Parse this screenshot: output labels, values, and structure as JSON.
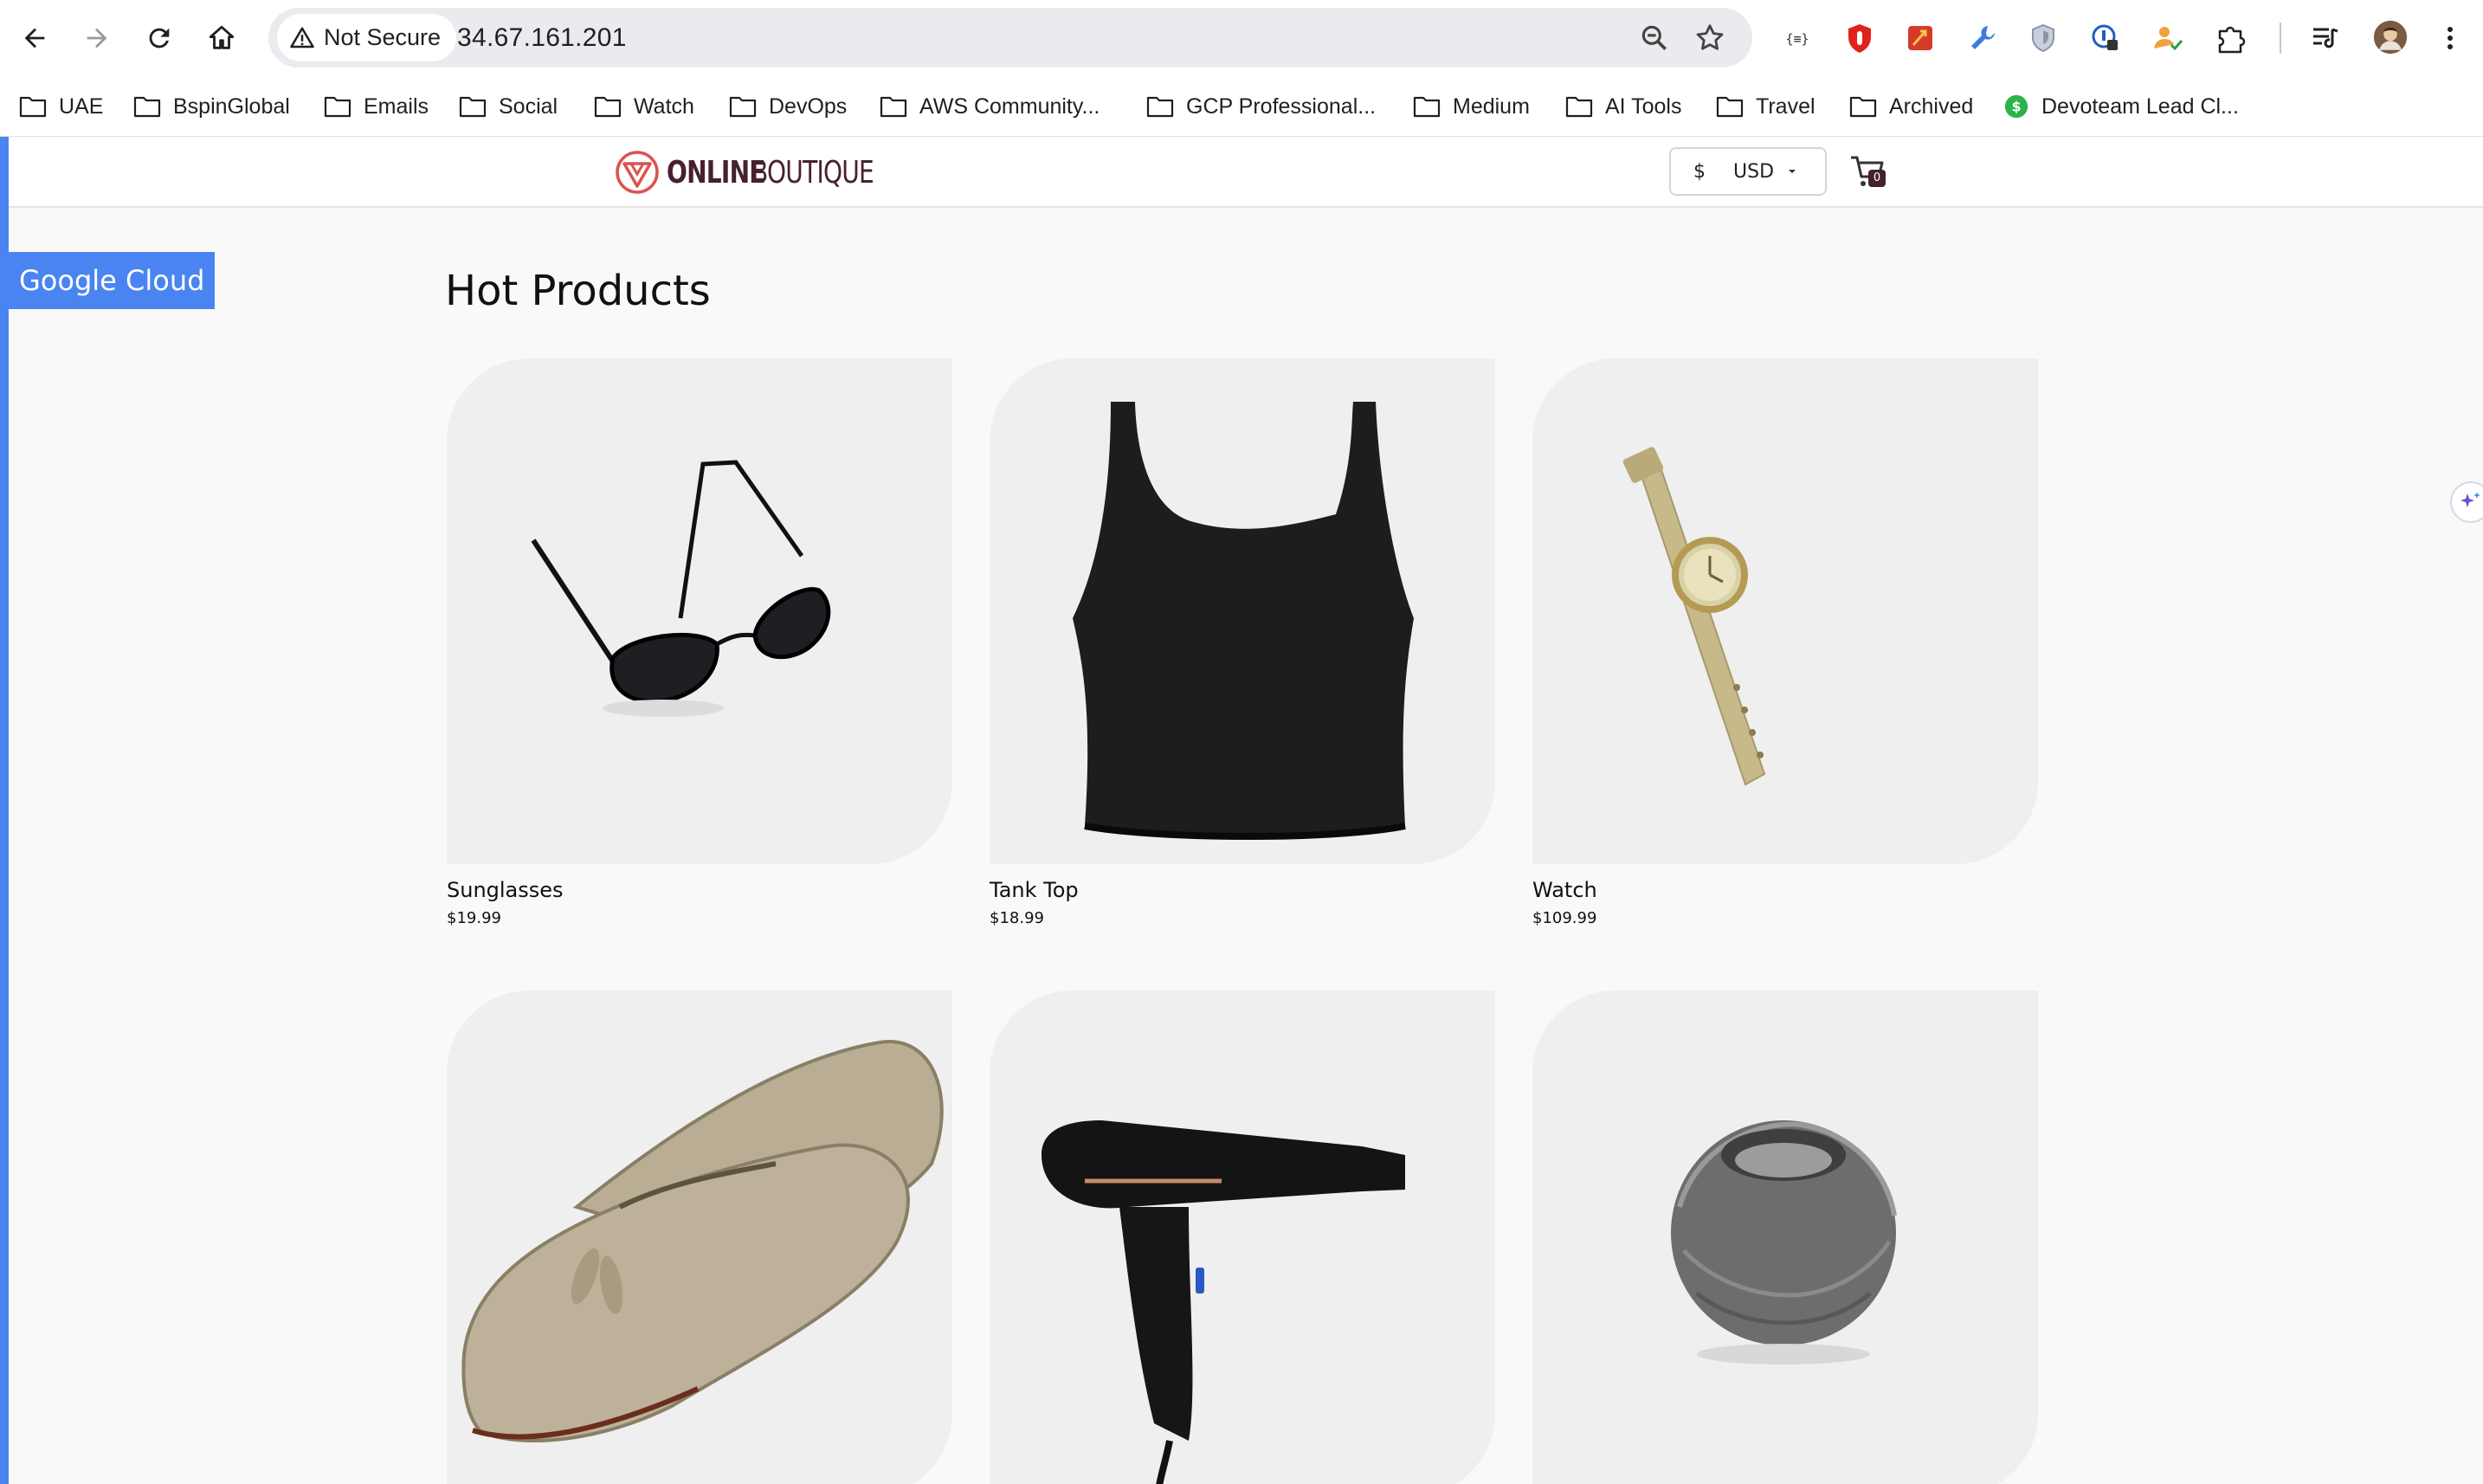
{
  "browser": {
    "security_label": "Not Secure",
    "url": "34.67.161.201",
    "nav_icons": [
      "back-arrow-icon",
      "forward-arrow-icon",
      "reload-icon",
      "home-icon"
    ],
    "omnibox_icons": [
      "zoom-icon",
      "bookmark-star-icon"
    ],
    "extension_icons": [
      "json-viewer-icon",
      "ublock-icon",
      "red-extension-icon",
      "wrench-icon",
      "shield-icon",
      "password-manager-icon",
      "person-check-icon",
      "extensions-puzzle-icon",
      "media-queue-icon",
      "profile-avatar",
      "more-menu-icon"
    ]
  },
  "bookmarks": [
    {
      "label": "UAE",
      "icon": "folder-icon"
    },
    {
      "label": "BspinGlobal",
      "icon": "folder-icon"
    },
    {
      "label": "Emails",
      "icon": "folder-icon"
    },
    {
      "label": "Social",
      "icon": "folder-icon"
    },
    {
      "label": "Watch",
      "icon": "folder-icon"
    },
    {
      "label": "DevOps",
      "icon": "folder-icon"
    },
    {
      "label": "AWS Community...",
      "icon": "folder-icon"
    },
    {
      "label": "GCP Professional...",
      "icon": "folder-icon"
    },
    {
      "label": "Medium",
      "icon": "folder-icon"
    },
    {
      "label": "AI Tools",
      "icon": "folder-icon"
    },
    {
      "label": "Travel",
      "icon": "folder-icon"
    },
    {
      "label": "Archived",
      "icon": "folder-icon"
    },
    {
      "label": "Devoteam Lead Cl...",
      "icon": "dollar-badge-icon"
    }
  ],
  "site": {
    "logo_bold": "ONLINE",
    "logo_light": "BOUTIQUE",
    "currency_symbol": "$",
    "currency_code": "USD",
    "cart_count": "0",
    "banner": "Google Cloud",
    "section_title": "Hot Products",
    "brand_color": "#47202e",
    "accent_color": "#4a84f0"
  },
  "products": [
    {
      "name": "Sunglasses",
      "price": "$19.99",
      "image": "sunglasses"
    },
    {
      "name": "Tank Top",
      "price": "$18.99",
      "image": "tank-top"
    },
    {
      "name": "Watch",
      "price": "$109.99",
      "image": "watch"
    },
    {
      "name": "",
      "price": "",
      "image": "loafers"
    },
    {
      "name": "",
      "price": "",
      "image": "hair-dryer"
    },
    {
      "name": "",
      "price": "",
      "image": "candle-holder"
    }
  ]
}
